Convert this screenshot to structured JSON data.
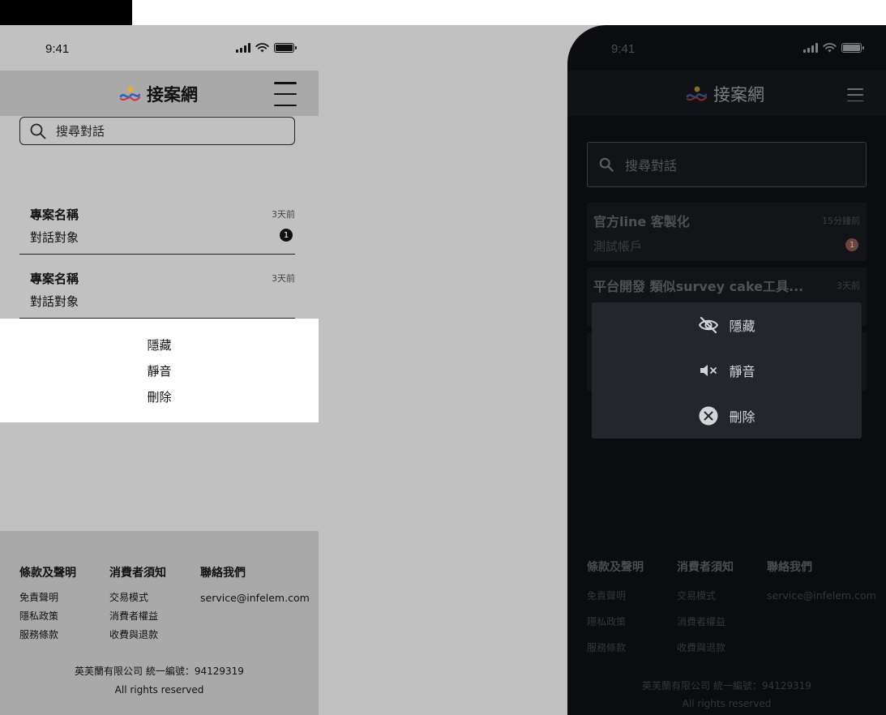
{
  "status_bar": {
    "time": "9:41"
  },
  "brand": {
    "name": "接案網",
    "logo_colors": [
      "#2a63c9",
      "#e6b11f",
      "#d9363e"
    ]
  },
  "wireframe": {
    "search": {
      "placeholder": "搜尋對話"
    },
    "conversations": [
      {
        "title": "專案名稱",
        "time": "3天前",
        "peer": "對話對象",
        "unread": "1"
      },
      {
        "title": "專案名稱",
        "time": "3天前",
        "peer": "對話對象",
        "unread": ""
      }
    ],
    "context_menu": [
      "隱藏",
      "靜音",
      "刪除"
    ]
  },
  "dark": {
    "search": {
      "placeholder": "搜尋對話"
    },
    "conversations": [
      {
        "title": "官方line 客製化",
        "time": "15分鐘前",
        "peer": "測試帳戶",
        "unread": "1"
      },
      {
        "title": "平台開發 類似survey cake工具...",
        "time": "3天前",
        "peer": "",
        "unread": ""
      }
    ],
    "context_menu": [
      {
        "label": "隱藏",
        "icon": "eye-off-icon"
      },
      {
        "label": "靜音",
        "icon": "speaker-mute-icon"
      },
      {
        "label": "刪除",
        "icon": "close-circle-icon"
      }
    ]
  },
  "footer": {
    "columns": [
      {
        "heading": "條款及聲明",
        "links": [
          "免責聲明",
          "隱私政策",
          "服務條款"
        ]
      },
      {
        "heading": "消費者須知",
        "links": [
          "交易模式",
          "消費者權益",
          "收費與退款"
        ]
      },
      {
        "heading": "聯絡我們",
        "links": [
          "service@infelem.com"
        ]
      }
    ],
    "company": "英芙蘭有限公司 統一編號：94129319",
    "rights": "All rights reserved"
  },
  "colors": {
    "wireframe_bg": "#c1c1c1",
    "wireframe_band": "#a9a9a9",
    "dark_bg": "#0b0c0f",
    "dark_menu": "#25262b",
    "badge_dark": "#6b4440"
  }
}
